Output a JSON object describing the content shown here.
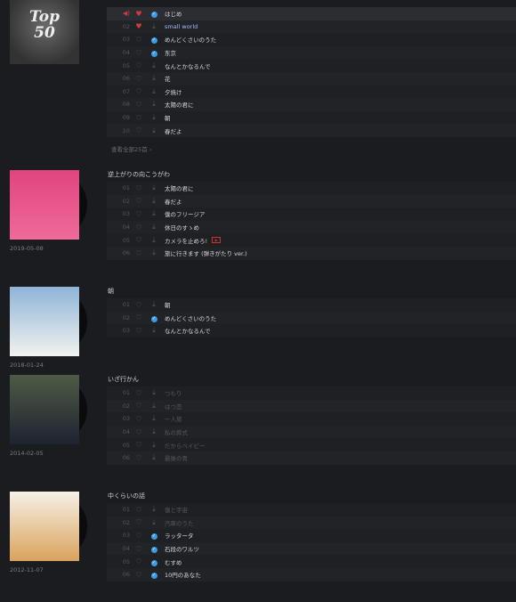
{
  "top": {
    "cover_text": "Top 50",
    "more_label": "查看全部25首 ›",
    "tracks": [
      {
        "n": "01",
        "t": "はじめ",
        "liked": true,
        "downloaded": true,
        "playing": true
      },
      {
        "n": "02",
        "t": "small world",
        "liked": true,
        "downloaded": false,
        "highlight": true
      },
      {
        "n": "03",
        "t": "めんどくさいのうた",
        "downloaded": true
      },
      {
        "n": "04",
        "t": "东京",
        "downloaded": true
      },
      {
        "n": "05",
        "t": "なんとかなるんで"
      },
      {
        "n": "06",
        "t": "花"
      },
      {
        "n": "07",
        "t": "夕焼け"
      },
      {
        "n": "08",
        "t": "太陽の君に"
      },
      {
        "n": "09",
        "t": "朝"
      },
      {
        "n": "10",
        "t": "春だよ"
      }
    ]
  },
  "albums": [
    {
      "title": "逆上がりの向こうがわ",
      "date": "2019-05-08",
      "cover_colors": [
        "#e0447f",
        "#f06a9a"
      ],
      "tracks": [
        {
          "n": "01",
          "t": "太陽の君に"
        },
        {
          "n": "02",
          "t": "春だよ"
        },
        {
          "n": "03",
          "t": "僕のフリージア"
        },
        {
          "n": "04",
          "t": "休日のすゝめ"
        },
        {
          "n": "05",
          "t": "カメラを止めろ!",
          "mv": true
        },
        {
          "n": "06",
          "t": "旅に行きます (弾きがたり ver.)"
        }
      ]
    },
    {
      "title": "朝",
      "date": "2018-01-24",
      "cover_colors": [
        "#8fb4d8",
        "#f2f2ee"
      ],
      "tracks": [
        {
          "n": "01",
          "t": "朝"
        },
        {
          "n": "02",
          "t": "めんどくさいのうた",
          "downloaded": true
        },
        {
          "n": "03",
          "t": "なんとかなるんで"
        }
      ]
    },
    {
      "title": "いざ行かん",
      "date": "2014-02-05",
      "cover_colors": [
        "#4f5a45",
        "#1e2330"
      ],
      "tracks": [
        {
          "n": "01",
          "t": "つもり",
          "dim": true
        },
        {
          "n": "02",
          "t": "はつ恋",
          "dim": true
        },
        {
          "n": "03",
          "t": "一人旅",
          "dim": true
        },
        {
          "n": "04",
          "t": "私の葬式",
          "dim": true
        },
        {
          "n": "05",
          "t": "だからベイビー",
          "dim": true
        },
        {
          "n": "06",
          "t": "最後の青",
          "dim": true
        }
      ]
    },
    {
      "title": "中くらいの話",
      "date": "2012-11-07",
      "cover_colors": [
        "#f6f1e6",
        "#d9a35c"
      ],
      "tracks": [
        {
          "n": "01",
          "t": "僕と宇宙",
          "dim": true
        },
        {
          "n": "02",
          "t": "汽車のうた",
          "dim": true
        },
        {
          "n": "03",
          "t": "ラッタータ",
          "downloaded": true
        },
        {
          "n": "04",
          "t": "石段のワルツ",
          "downloaded": true
        },
        {
          "n": "05",
          "t": "むすめ",
          "downloaded": true
        },
        {
          "n": "06",
          "t": "10円のあなた",
          "downloaded": true
        }
      ]
    }
  ]
}
